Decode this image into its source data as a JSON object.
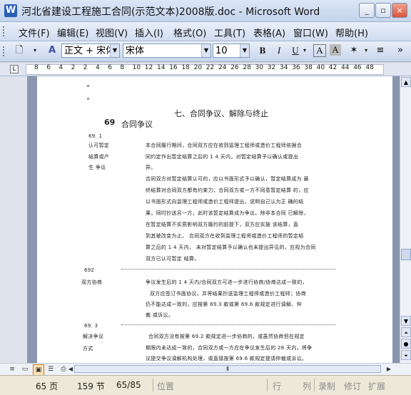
{
  "window": {
    "title": "河北省建设工程施工合同(示范文本)2008版.doc - Microsoft Word",
    "icon": "W"
  },
  "window_buttons": {
    "minimize": "_",
    "restore": "▫",
    "close": "×"
  },
  "menu": [
    "文件(F)",
    "编辑(E)",
    "视图(V)",
    "插入(I)",
    "格式(O)",
    "工具(T)",
    "表格(A)",
    "窗口(W)",
    "帮助(H)"
  ],
  "toolbar": {
    "style": "正文 + 宋体",
    "font": "宋体",
    "size": "10",
    "bold": "B",
    "italic": "I",
    "underline": "U"
  },
  "ruler": {
    "numbers": [
      "8",
      "6",
      "4",
      "2",
      "2",
      "4",
      "6",
      "8",
      "10",
      "12",
      "14",
      "16",
      "18",
      "20",
      "22",
      "24",
      "26",
      "28",
      "30",
      "32",
      "34",
      "36",
      "38",
      "40",
      "42",
      "44",
      "46",
      "48"
    ]
  },
  "document": {
    "chapter_heading": "七、合同争议、解除与终止",
    "section_number": "69",
    "section_title": "合同争议",
    "clause1_number": "69. 1",
    "clause1_side": [
      "认可暂定",
      "结算或产",
      "生 争议"
    ],
    "clause1_p1": [
      "本合同履行期间，合同双方应在收到监理工程师或造价工程师依据合",
      "同约定作出暂定结算之后的 1 4 天内，对暂定结算予以确认或提出",
      "异。"
    ],
    "clause1_p2": [
      "合同双方对暂定结算认可的，应以书面形式予以确认，暂定结算成为 最",
      "终结算对合同双方都有约束力；合同双方或一方不同意暂定结算 的，应",
      "以书面形式向监理工程师或造价工程师提出，说明自己认为正 确的结",
      "果，同时抄送另一方，此时该暂定结算成为争议。除非本合同 已解除，",
      "在暂定结算不实质影响双方履约的前提下，双方应实施 该结算，直",
      "到其被改变为止。 合同双方在收到监理工程师或造价工程师的暂定结",
      "算之后的 1 4 天内， 未对暂定结算予以确认也未提出异见的，应视为合同",
      "双方已认可暂定 结算。"
    ],
    "clause2_number": "692",
    "clause2_side": "双方协商",
    "clause2_lines": [
      "争议发生后的 1 4 天内/合同双方可进一步进行协商/协商达成一致的，",
      "双方应签订书面协议，并将结果抄送监理工程师或造价工程师；协商",
      "仍不能达成一致的，应按第 69.3 款或第 69.6 款规定进行调解、仲",
      "裁 或诉讼。"
    ],
    "clause3_number": "69. 3",
    "clause3_side": [
      "解决争议",
      "方式"
    ],
    "clause3_lines": [
      "合同双方没有按第 69.2 款规定进一步协商的，或虽然协商但在规定",
      "期限内未达成一致的，合同双方或一方应在争议发生后的 28 天内，将争",
      "议提交争议调解机构处理，或直接按第 69.6 款规定提请仲裁或诉讼。"
    ]
  },
  "status_bar": {
    "page": "65 页",
    "section": "159 节",
    "page_of": "65/85",
    "position": "位置",
    "line": "行",
    "column": "列",
    "rec": "录制",
    "trk": "修订",
    "ext": "扩展"
  }
}
